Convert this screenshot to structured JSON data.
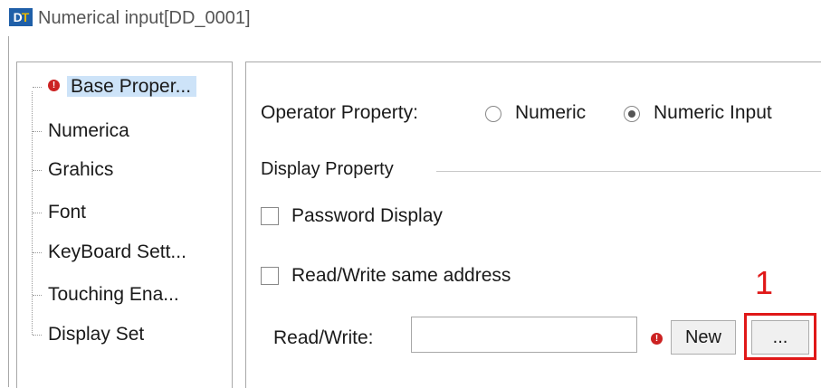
{
  "window": {
    "title": "Numerical input[DD_0001]",
    "icon_text": "DT"
  },
  "tree": {
    "items": [
      {
        "label": "Base Proper...",
        "selected": true,
        "has_error": true
      },
      {
        "label": "Numerica"
      },
      {
        "label": "Grahics"
      },
      {
        "label": "Font"
      },
      {
        "label": "KeyBoard Sett..."
      },
      {
        "label": "Touching Ena..."
      },
      {
        "label": "Display Set"
      }
    ]
  },
  "content": {
    "operator_property_label": "Operator Property:",
    "radio_options": [
      {
        "label": "Numeric",
        "checked": false
      },
      {
        "label": "Numeric Input",
        "checked": true
      }
    ],
    "display_property_title": "Display Property",
    "password_display_label": "Password Display",
    "read_write_same_label": "Read/Write same address",
    "read_write_label": "Read/Write:",
    "read_write_value": "",
    "new_button_label": "New",
    "browse_button_label": "...",
    "annotation_number": "1"
  },
  "colors": {
    "selection": "#cde3f8",
    "error": "#cc2222",
    "annotation": "#e01818"
  }
}
